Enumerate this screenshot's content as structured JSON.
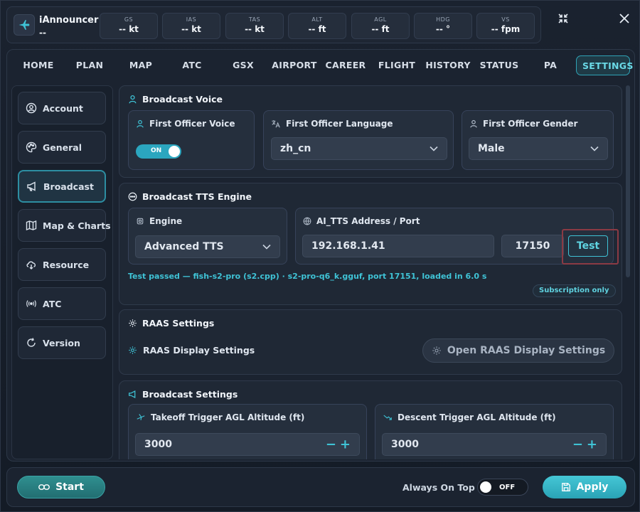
{
  "app": {
    "name": "iAnnouncer",
    "status": "--"
  },
  "stats": [
    {
      "label": "GS",
      "value": "-- kt"
    },
    {
      "label": "IAS",
      "value": "-- kt"
    },
    {
      "label": "TAS",
      "value": "-- kt"
    },
    {
      "label": "ALT",
      "value": "-- ft"
    },
    {
      "label": "AGL",
      "value": "-- ft"
    },
    {
      "label": "HDG",
      "value": "-- °"
    },
    {
      "label": "VS",
      "value": "-- fpm"
    }
  ],
  "tabs": [
    "HOME",
    "PLAN",
    "MAP",
    "ATC",
    "GSX",
    "AIRPORT",
    "CAREER",
    "FLIGHT",
    "HISTORY",
    "STATUS",
    "PA",
    "SETTINGS"
  ],
  "active_tab": "SETTINGS",
  "sidebar": {
    "items": [
      {
        "label": "Account",
        "icon": "account-icon"
      },
      {
        "label": "General",
        "icon": "palette-icon"
      },
      {
        "label": "Broadcast",
        "icon": "megaphone-icon"
      },
      {
        "label": "Map & Charts",
        "icon": "map-icon"
      },
      {
        "label": "Resource",
        "icon": "cloud-download-icon"
      },
      {
        "label": "ATC",
        "icon": "radio-waves-icon"
      },
      {
        "label": "Version",
        "icon": "refresh-icon"
      }
    ],
    "active": "Broadcast"
  },
  "broadcast_voice": {
    "title": "Broadcast Voice",
    "fo_voice": {
      "label": "First Officer Voice",
      "toggle": "ON"
    },
    "fo_language": {
      "label": "First Officer Language",
      "value": "zh_cn"
    },
    "fo_gender": {
      "label": "First Officer Gender",
      "value": "Male"
    }
  },
  "tts_engine": {
    "title": "Broadcast TTS Engine",
    "engine": {
      "label": "Engine",
      "value": "Advanced TTS"
    },
    "address": {
      "label": "AI_TTS Address / Port",
      "host": "192.168.1.41",
      "port": "17150",
      "test_label": "Test"
    },
    "status": "Test passed — fish-s2-pro (s2.cpp) · s2-pro-q6_k.gguf, port 17151, loaded in 6.0 s",
    "badge": "Subscription only"
  },
  "raas": {
    "title": "RAAS Settings",
    "display_label": "RAAS Display Settings",
    "open_button": "Open RAAS Display Settings"
  },
  "broadcast_settings": {
    "title": "Broadcast Settings",
    "takeoff": {
      "label": "Takeoff Trigger AGL Altitude (ft)",
      "value": "3000"
    },
    "descent": {
      "label": "Descent Trigger AGL Altitude (ft)",
      "value": "3000"
    }
  },
  "footer": {
    "start": "Start",
    "always_on_top": "Always On Top",
    "toggle": "OFF",
    "apply": "Apply"
  },
  "colors": {
    "accent": "#3fc3d6",
    "status_text": "#3fc3d6",
    "highlight_box": "#8b3a44"
  }
}
